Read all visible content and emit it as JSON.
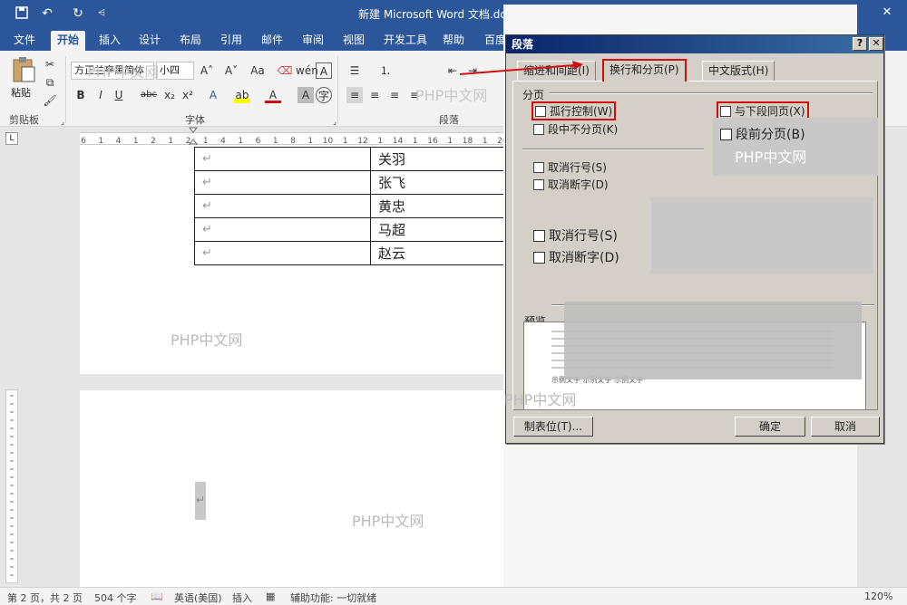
{
  "window": {
    "title": "新建 Microsoft Word 文档.docx",
    "close_glyph": "✕"
  },
  "quick_access": [
    "save-icon",
    "undo-icon",
    "redo-icon",
    "customize-icon"
  ],
  "ribbon_tabs": [
    "文件",
    "开始",
    "插入",
    "设计",
    "布局",
    "引用",
    "邮件",
    "审阅",
    "视图",
    "开发工具",
    "帮助",
    "百度"
  ],
  "ribbon": {
    "clipboard_label": "剪贴板",
    "paste_label": "粘贴",
    "font_label": "字体",
    "paragraph_label": "段落",
    "font_name": "方正兰亭黑简体",
    "font_size": "小四",
    "font_buttons": [
      "B",
      "I",
      "U",
      "abc",
      "x₂",
      "x²"
    ]
  },
  "ruler": {
    "ticks": [
      "6",
      "1",
      "4",
      "1",
      "2",
      "1",
      "2",
      "1",
      "4",
      "1",
      "6",
      "1",
      "8",
      "1",
      "10",
      "1",
      "12",
      "1",
      "14",
      "1",
      "16",
      "1",
      "18",
      "1",
      "20"
    ]
  },
  "table_rows": [
    {
      "c1": "↵",
      "c2": "关羽"
    },
    {
      "c1": "↵",
      "c2": "张飞"
    },
    {
      "c1": "↵",
      "c2": "黄忠"
    },
    {
      "c1": "↵",
      "c2": "马超"
    },
    {
      "c1": "↵",
      "c2": "赵云"
    }
  ],
  "watermarks": {
    "wm1": "PHP中文网",
    "wm2": "PHP中文网",
    "wm3": "PHP中文网",
    "wm4": "PHP中文网",
    "wm5": "PHP中文网",
    "wm6": "PHP中文网"
  },
  "page2_mark": "↵",
  "dialog": {
    "title": "段落",
    "help_btn": "?",
    "close_btn": "✕",
    "tabs": [
      "缩进和间距(I)",
      "换行和分页(P)",
      "中文版式(H)"
    ],
    "section_pagination": "分页",
    "checkboxes_left": [
      "孤行控制(W)",
      "段中不分页(K)"
    ],
    "checkboxes_right": [
      "与下段同页(X)"
    ],
    "overlay_right": "段前分页(B)",
    "suppress": [
      "取消行号(S)",
      "取消断字(D)"
    ],
    "suppress_big": [
      "取消行号(S)",
      "取消断字(D)"
    ],
    "preview_label": "预览",
    "preview_text": "示例文字 示例文字 示例文字",
    "tabs_button": "制表位(T)...",
    "ok_button": "确定",
    "cancel_button": "取消"
  },
  "status": {
    "page": "第 2 页，共 2 页",
    "words": "504 个字",
    "language": "英语(美国)",
    "mode": "插入",
    "accessibility": "辅助功能: 一切就绪",
    "zoom": "120%"
  },
  "colors": {
    "accent": "#2b579a",
    "highlight": "#d01010"
  }
}
